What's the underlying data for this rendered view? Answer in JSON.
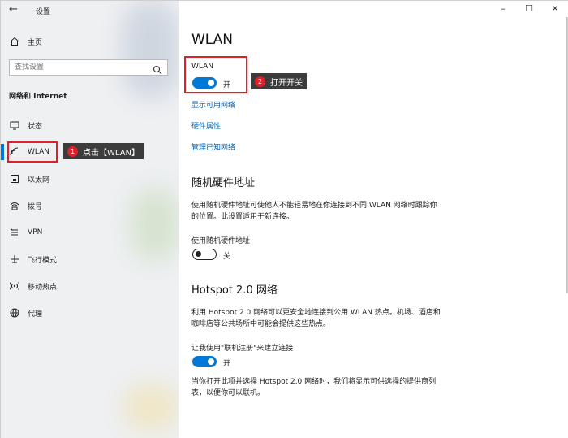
{
  "window": {
    "title": "设置",
    "minimize": "–",
    "maximize": "☐",
    "close": "✕"
  },
  "sidebar": {
    "home": "主页",
    "search_placeholder": "查找设置",
    "section": "网络和 Internet",
    "items": [
      {
        "label": "状态",
        "icon": "status-icon"
      },
      {
        "label": "WLAN",
        "icon": "wifi-icon"
      },
      {
        "label": "以太网",
        "icon": "ethernet-icon"
      },
      {
        "label": "拨号",
        "icon": "dialup-icon"
      },
      {
        "label": "VPN",
        "icon": "vpn-icon"
      },
      {
        "label": "飞行模式",
        "icon": "airplane-icon"
      },
      {
        "label": "移动热点",
        "icon": "hotspot-icon"
      },
      {
        "label": "代理",
        "icon": "globe-icon"
      }
    ]
  },
  "annotations": {
    "step1": {
      "number": "1",
      "text": "点击【WLAN】"
    },
    "step2": {
      "number": "2",
      "text": "打开开关"
    }
  },
  "main": {
    "title": "WLAN",
    "wlan_label": "WLAN",
    "wlan_state": "开",
    "links": [
      "显示可用网络",
      "硬件属性",
      "管理已知网络"
    ],
    "random_hw": {
      "heading": "随机硬件地址",
      "description": "使用随机硬件地址可使他人不能轻易地在你连接到不同 WLAN 网络时跟踪你的位置。此设置适用于新连接。",
      "toggle_label": "使用随机硬件地址",
      "toggle_state": "关"
    },
    "hotspot": {
      "heading": "Hotspot 2.0 网络",
      "description": "利用 Hotspot 2.0 网络可以更安全地连接到公用 WLAN 热点。机场、酒店和咖啡店等公共场所中可能会提供这些热点。",
      "toggle_label": "让我使用\"联机注册\"来建立连接",
      "toggle_state": "开",
      "footer": "当你打开此项并选择 Hotspot 2.0 网络时，我们将显示可供选择的提供商列表，以便你可以联机。"
    }
  },
  "colors": {
    "accent": "#0078d7",
    "link": "#0063b1",
    "annotation_red": "#e0202a"
  }
}
